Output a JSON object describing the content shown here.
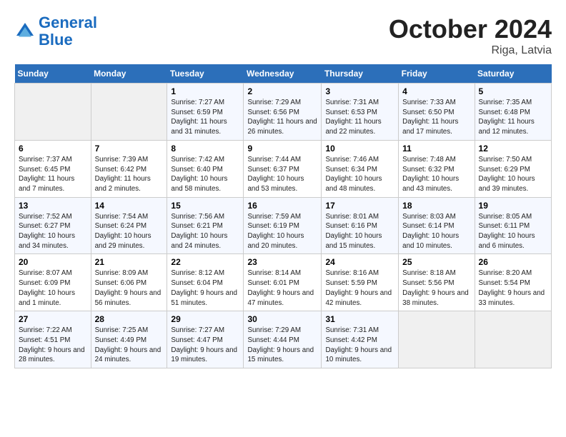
{
  "header": {
    "logo_line1": "General",
    "logo_line2": "Blue",
    "month": "October 2024",
    "location": "Riga, Latvia"
  },
  "weekdays": [
    "Sunday",
    "Monday",
    "Tuesday",
    "Wednesday",
    "Thursday",
    "Friday",
    "Saturday"
  ],
  "weeks": [
    [
      {
        "day": "",
        "info": ""
      },
      {
        "day": "",
        "info": ""
      },
      {
        "day": "1",
        "info": "Sunrise: 7:27 AM\nSunset: 6:59 PM\nDaylight: 11 hours and 31 minutes."
      },
      {
        "day": "2",
        "info": "Sunrise: 7:29 AM\nSunset: 6:56 PM\nDaylight: 11 hours and 26 minutes."
      },
      {
        "day": "3",
        "info": "Sunrise: 7:31 AM\nSunset: 6:53 PM\nDaylight: 11 hours and 22 minutes."
      },
      {
        "day": "4",
        "info": "Sunrise: 7:33 AM\nSunset: 6:50 PM\nDaylight: 11 hours and 17 minutes."
      },
      {
        "day": "5",
        "info": "Sunrise: 7:35 AM\nSunset: 6:48 PM\nDaylight: 11 hours and 12 minutes."
      }
    ],
    [
      {
        "day": "6",
        "info": "Sunrise: 7:37 AM\nSunset: 6:45 PM\nDaylight: 11 hours and 7 minutes."
      },
      {
        "day": "7",
        "info": "Sunrise: 7:39 AM\nSunset: 6:42 PM\nDaylight: 11 hours and 2 minutes."
      },
      {
        "day": "8",
        "info": "Sunrise: 7:42 AM\nSunset: 6:40 PM\nDaylight: 10 hours and 58 minutes."
      },
      {
        "day": "9",
        "info": "Sunrise: 7:44 AM\nSunset: 6:37 PM\nDaylight: 10 hours and 53 minutes."
      },
      {
        "day": "10",
        "info": "Sunrise: 7:46 AM\nSunset: 6:34 PM\nDaylight: 10 hours and 48 minutes."
      },
      {
        "day": "11",
        "info": "Sunrise: 7:48 AM\nSunset: 6:32 PM\nDaylight: 10 hours and 43 minutes."
      },
      {
        "day": "12",
        "info": "Sunrise: 7:50 AM\nSunset: 6:29 PM\nDaylight: 10 hours and 39 minutes."
      }
    ],
    [
      {
        "day": "13",
        "info": "Sunrise: 7:52 AM\nSunset: 6:27 PM\nDaylight: 10 hours and 34 minutes."
      },
      {
        "day": "14",
        "info": "Sunrise: 7:54 AM\nSunset: 6:24 PM\nDaylight: 10 hours and 29 minutes."
      },
      {
        "day": "15",
        "info": "Sunrise: 7:56 AM\nSunset: 6:21 PM\nDaylight: 10 hours and 24 minutes."
      },
      {
        "day": "16",
        "info": "Sunrise: 7:59 AM\nSunset: 6:19 PM\nDaylight: 10 hours and 20 minutes."
      },
      {
        "day": "17",
        "info": "Sunrise: 8:01 AM\nSunset: 6:16 PM\nDaylight: 10 hours and 15 minutes."
      },
      {
        "day": "18",
        "info": "Sunrise: 8:03 AM\nSunset: 6:14 PM\nDaylight: 10 hours and 10 minutes."
      },
      {
        "day": "19",
        "info": "Sunrise: 8:05 AM\nSunset: 6:11 PM\nDaylight: 10 hours and 6 minutes."
      }
    ],
    [
      {
        "day": "20",
        "info": "Sunrise: 8:07 AM\nSunset: 6:09 PM\nDaylight: 10 hours and 1 minute."
      },
      {
        "day": "21",
        "info": "Sunrise: 8:09 AM\nSunset: 6:06 PM\nDaylight: 9 hours and 56 minutes."
      },
      {
        "day": "22",
        "info": "Sunrise: 8:12 AM\nSunset: 6:04 PM\nDaylight: 9 hours and 51 minutes."
      },
      {
        "day": "23",
        "info": "Sunrise: 8:14 AM\nSunset: 6:01 PM\nDaylight: 9 hours and 47 minutes."
      },
      {
        "day": "24",
        "info": "Sunrise: 8:16 AM\nSunset: 5:59 PM\nDaylight: 9 hours and 42 minutes."
      },
      {
        "day": "25",
        "info": "Sunrise: 8:18 AM\nSunset: 5:56 PM\nDaylight: 9 hours and 38 minutes."
      },
      {
        "day": "26",
        "info": "Sunrise: 8:20 AM\nSunset: 5:54 PM\nDaylight: 9 hours and 33 minutes."
      }
    ],
    [
      {
        "day": "27",
        "info": "Sunrise: 7:22 AM\nSunset: 4:51 PM\nDaylight: 9 hours and 28 minutes."
      },
      {
        "day": "28",
        "info": "Sunrise: 7:25 AM\nSunset: 4:49 PM\nDaylight: 9 hours and 24 minutes."
      },
      {
        "day": "29",
        "info": "Sunrise: 7:27 AM\nSunset: 4:47 PM\nDaylight: 9 hours and 19 minutes."
      },
      {
        "day": "30",
        "info": "Sunrise: 7:29 AM\nSunset: 4:44 PM\nDaylight: 9 hours and 15 minutes."
      },
      {
        "day": "31",
        "info": "Sunrise: 7:31 AM\nSunset: 4:42 PM\nDaylight: 9 hours and 10 minutes."
      },
      {
        "day": "",
        "info": ""
      },
      {
        "day": "",
        "info": ""
      }
    ]
  ]
}
